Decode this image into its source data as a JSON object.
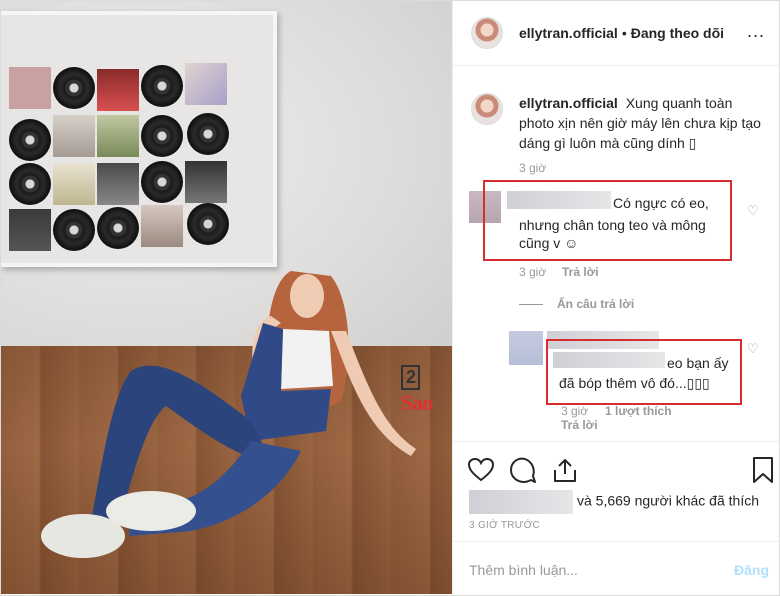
{
  "header": {
    "username": "ellytran.official",
    "separator": "•",
    "follow_status": "Đang theo dõi",
    "more": "..."
  },
  "caption": {
    "username": "ellytran.official",
    "text": "Xung quanh toàn photo xịn nên giờ máy lên chưa kịp tạo dáng gì luôn mà cũng dính ▯",
    "time": "3 giờ"
  },
  "comments": [
    {
      "text_line1": "Có ngực có eo,",
      "text_line2": "nhưng chân tong teo và mông",
      "text_line3": "cũng v ☺",
      "time": "3 giờ",
      "reply": "Trả lời"
    },
    {
      "text_line1": "eo bạn ấy",
      "text_line2": "đã bóp thêm vô đó...▯▯▯",
      "time": "3 giờ",
      "likes": "1 lượt thích",
      "reply": "Trả lời"
    }
  ],
  "hide_replies": "Ẩn câu trả lời",
  "likes_text": "và 5,669 người khác đã thích",
  "post_age": "3 GIỜ TRƯỚC",
  "add_comment_placeholder": "Thêm bình luận...",
  "post_button": "Đăng",
  "watermark": {
    "box": "2",
    "text": "Sao"
  },
  "colors": {
    "highlight_box": "#d92c2c",
    "post_button": "#b2dffc",
    "meta": "#999999"
  }
}
